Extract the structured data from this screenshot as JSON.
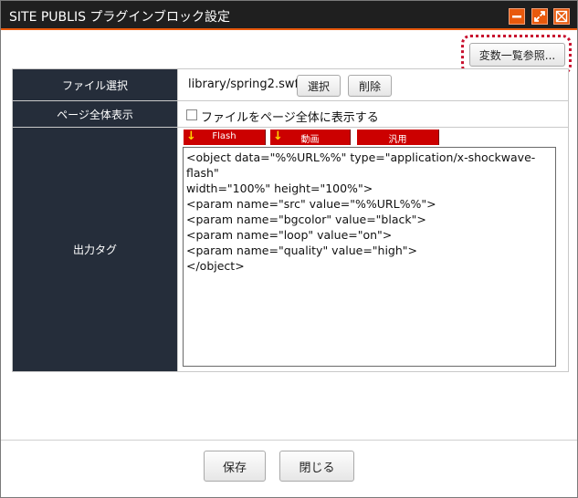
{
  "window": {
    "title": "SITE PUBLIS プラグインブロック設定",
    "buttons": {
      "minimize": "minimize-icon",
      "maximize": "maximize-icon",
      "close": "close-icon"
    },
    "accent": "#e8590c"
  },
  "toolbar": {
    "variables_button": "変数一覧参照..."
  },
  "form": {
    "file_select": {
      "label": "ファイル選択",
      "path": "library/spring2.swf",
      "select_button": "選択",
      "delete_button": "削除"
    },
    "full_page": {
      "label": "ページ全体表示",
      "checkbox_label": "ファイルをページ全体に表示する",
      "checked": false
    },
    "output_tag": {
      "label": "出力タグ",
      "templates": [
        "Flash",
        "動画",
        "汎用"
      ],
      "content": "<object data=\"%%URL%%\" type=\"application/x-shockwave-flash\"\nwidth=\"100%\" height=\"100%\">\n<param name=\"src\" value=\"%%URL%%\">\n<param name=\"bgcolor\" value=\"black\">\n<param name=\"loop\" value=\"on\">\n<param name=\"quality\" value=\"high\">\n</object>"
    }
  },
  "footer": {
    "save_button": "保存",
    "close_button": "閉じる"
  }
}
